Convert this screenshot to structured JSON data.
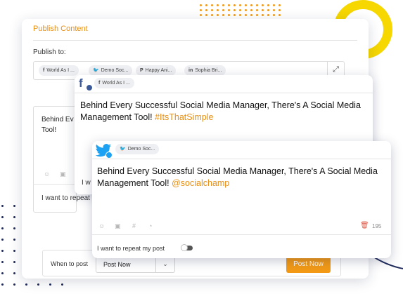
{
  "colors": {
    "accent": "#e88f15",
    "yellow": "#f6d700",
    "navy": "#1f2a5a",
    "twitter": "#1da1f2",
    "facebook": "#3b5998",
    "button": "#f39a16"
  },
  "main": {
    "title": "Publish Content",
    "publish_to_label": "Publish to:",
    "accounts": [
      {
        "icon": "f",
        "icon_name": "facebook-icon",
        "label": "World As I ..."
      },
      {
        "icon": "🐦",
        "icon_name": "twitter-icon",
        "label": "Demo Soc..."
      },
      {
        "icon": "P",
        "icon_name": "pinterest-icon",
        "label": "Happy Ani..."
      },
      {
        "icon": "in",
        "icon_name": "linkedin-icon",
        "label": "Sophia Bri..."
      }
    ],
    "behind_text": "Behind Ev",
    "behind_text2": "Tool!",
    "repeat_partial": "I want to repeat",
    "when_to_post_label": "When to post",
    "when_to_post_value": "Post Now",
    "post_now_button": "Post Now"
  },
  "facebook_card": {
    "account_icon": "f",
    "account_label": "World As I ...",
    "post_text": "Behind Every Successful Social Media Manager, There's A Social Media Management Tool! ",
    "hashtag": "#ItsThatSimple",
    "partial_label": "I w"
  },
  "twitter_card": {
    "account_label": "Demo Soc...",
    "post_text": "Behind Every Successful Social Media Manager, There's A Social Media Management Tool! ",
    "mention": "@socialchamp",
    "char_count": "195",
    "repeat_label": "I want to repeat my post"
  }
}
